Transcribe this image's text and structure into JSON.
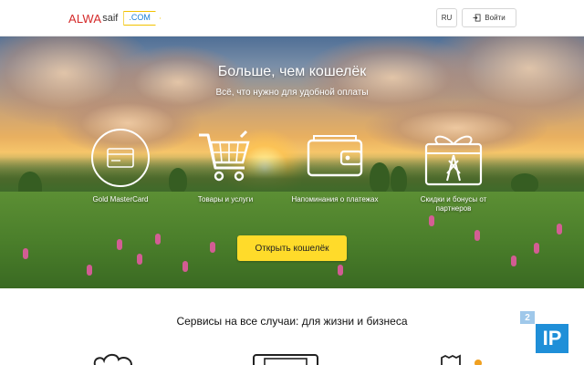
{
  "header": {
    "logo_part1": "ALWA",
    "logo_part2": "saif",
    "logo_domain": ".COM",
    "lang_label": "RU",
    "login_label": "Войти"
  },
  "hero": {
    "title": "Больше, чем кошелёк",
    "subtitle": "Всё, что нужно для удобной оплаты",
    "features": [
      {
        "label": "Gold MasterCard",
        "icon": "card-icon"
      },
      {
        "label": "Товары и услуги",
        "icon": "cart-icon"
      },
      {
        "label": "Напоминания о платежах",
        "icon": "wallet-icon"
      },
      {
        "label": "Скидки и бонусы от партнеров",
        "icon": "gift-icon"
      }
    ],
    "cta_label": "Открыть кошелёк"
  },
  "services": {
    "title": "Сервисы на все случаи: для жизни и бизнеса"
  },
  "badge": {
    "small": "2",
    "large": "IP"
  },
  "colors": {
    "brand_red": "#d42a2a",
    "domain_blue": "#1a7fd6",
    "domain_border": "#f2c200",
    "cta_yellow": "#ffdb2a",
    "badge_blue": "#1f8fd8"
  }
}
